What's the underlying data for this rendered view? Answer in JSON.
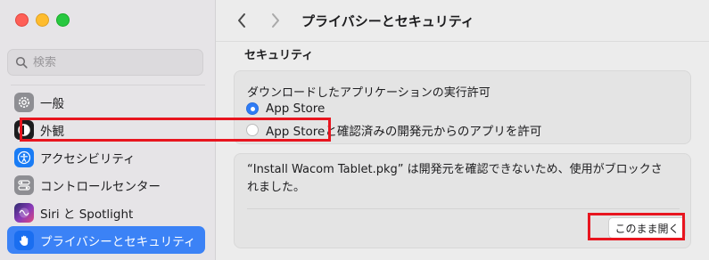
{
  "sidebar": {
    "search": {
      "placeholder": "検索",
      "value": ""
    },
    "items": [
      {
        "label": "一般",
        "icon": "gear-icon"
      },
      {
        "label": "外観",
        "icon": "appearance-icon"
      },
      {
        "label": "アクセシビリティ",
        "icon": "accessibility-icon"
      },
      {
        "label": "コントロールセンター",
        "icon": "control-center-icon"
      },
      {
        "label": "Siri と Spotlight",
        "icon": "siri-icon"
      },
      {
        "label": "プライバシーとセキュリティ",
        "icon": "hand-icon",
        "selected": true
      }
    ]
  },
  "toolbar": {
    "title": "プライバシーとセキュリティ"
  },
  "security": {
    "section_title": "セキュリティ",
    "allow_label": "ダウンロードしたアプリケーションの実行許可",
    "options": [
      {
        "label": "App Store",
        "selected": true
      },
      {
        "label": "App Storeと確認済みの開発元からのアプリを許可",
        "selected": false
      }
    ],
    "message_line1": "“Install Wacom Tablet.pkg” は開発元を確認できないため、使用がブロックさ",
    "message_line2": "れました。",
    "open_anyway_label": "このまま開く"
  },
  "colors": {
    "accent": "#3b82f6",
    "highlight_box": "#e8151f"
  }
}
